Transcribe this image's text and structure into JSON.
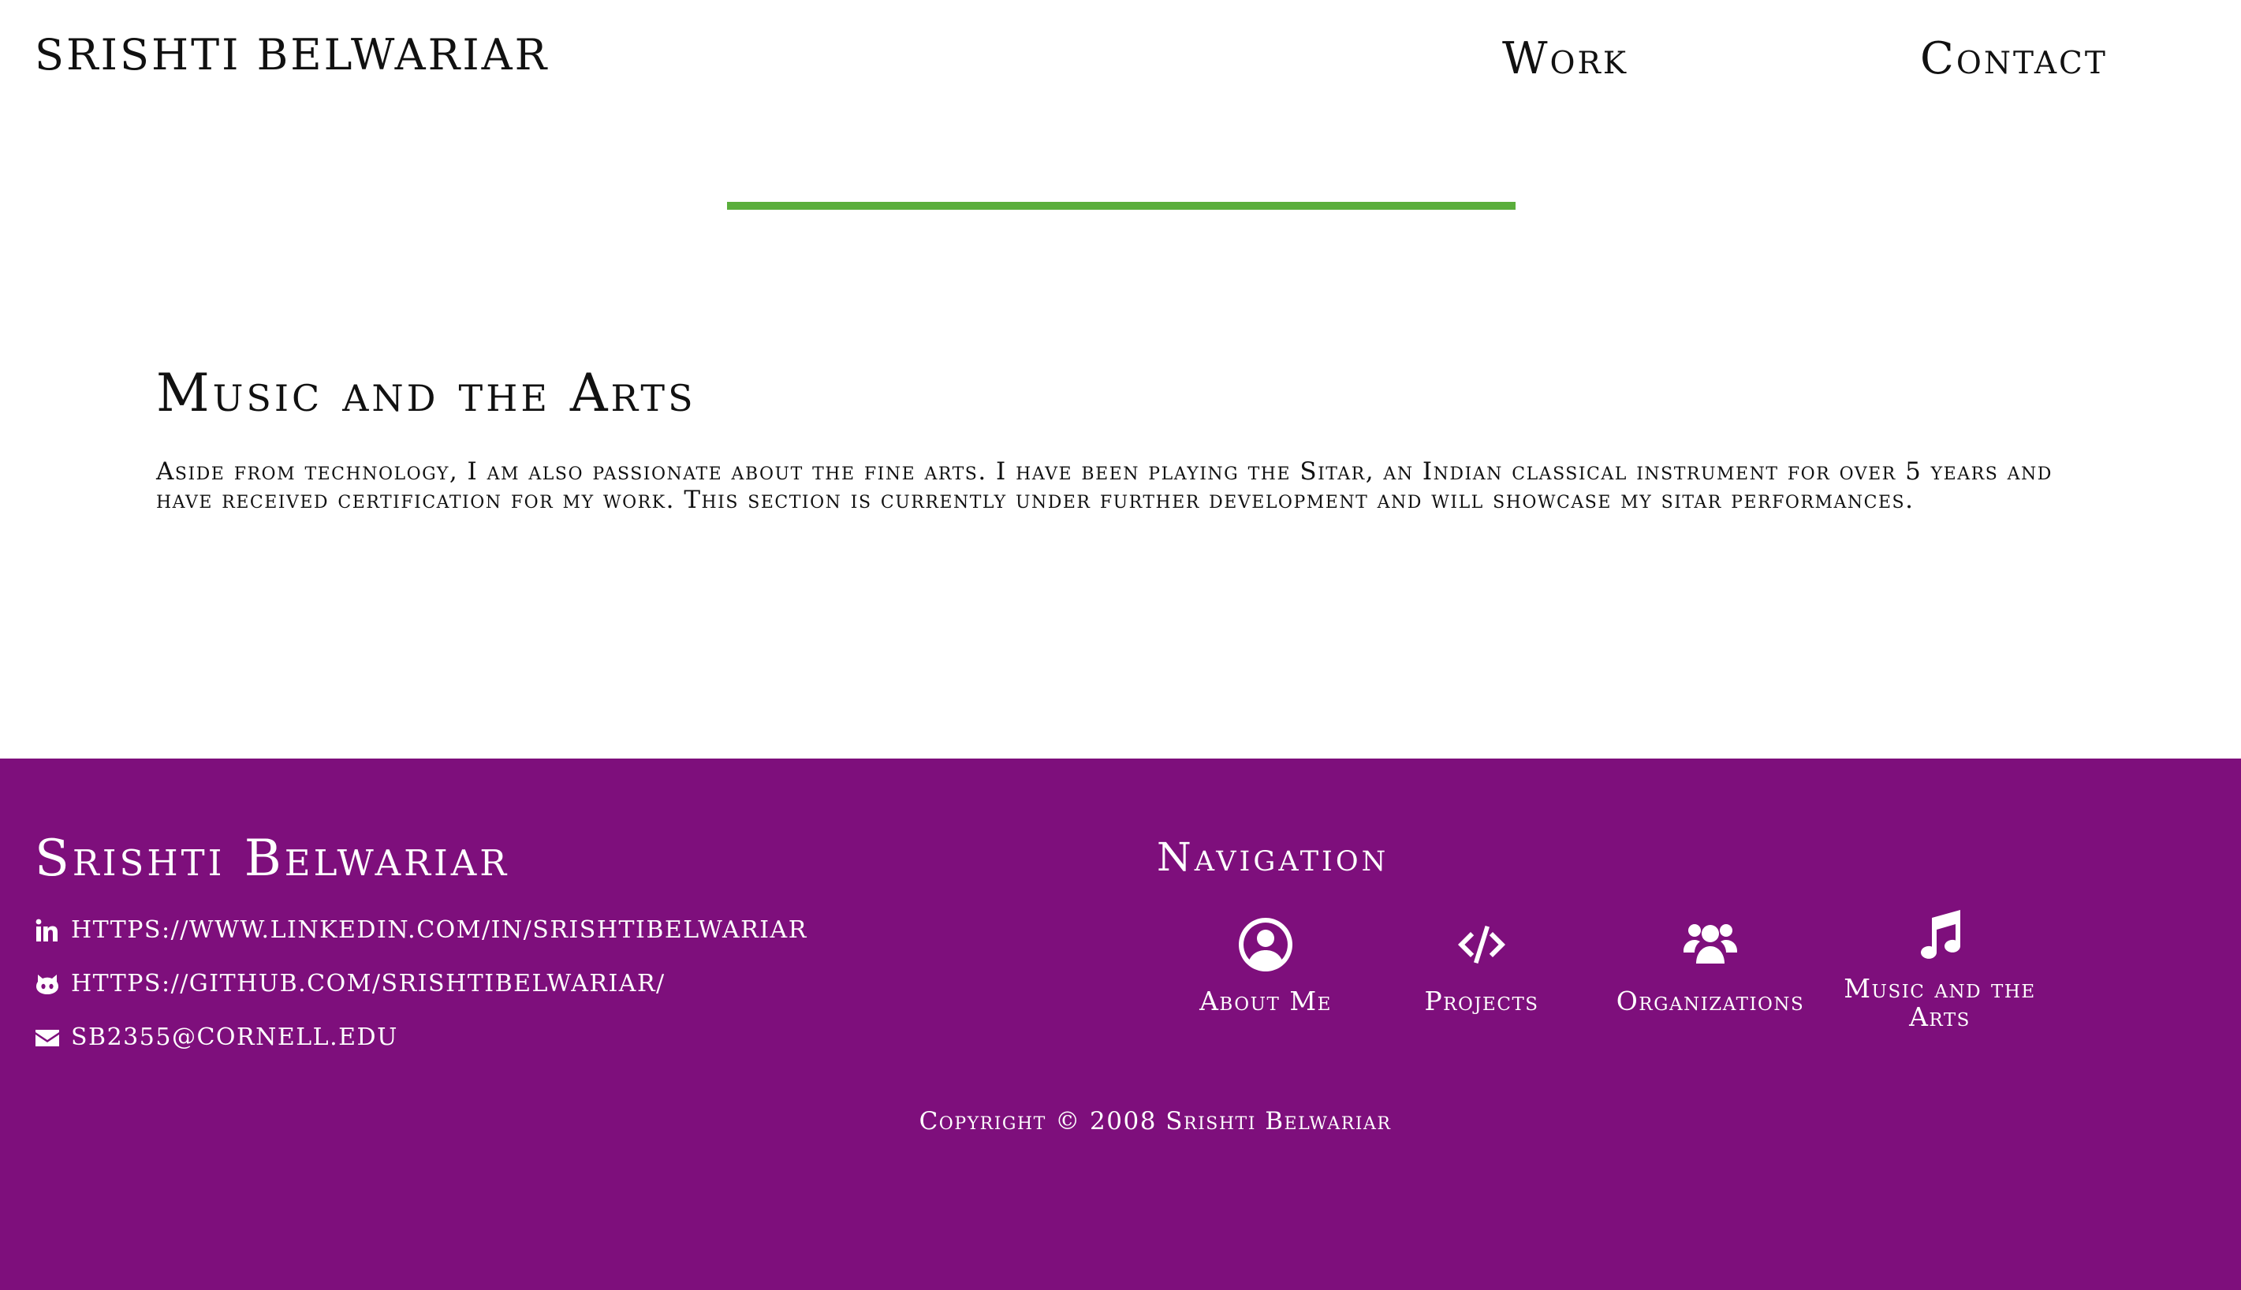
{
  "header": {
    "brand": "SRISHTI BELWARIAR",
    "nav": {
      "work": "Work",
      "contact": "Contact"
    }
  },
  "accent_color": "#5aae3c",
  "section": {
    "title": "Music and the Arts",
    "body": "Aside from technology, I am also passionate about the fine arts. I have been playing the Sitar, an Indian classical instrument for over 5 years and have received certification for my work. This section is currently under further development and will showcase my sitar performances."
  },
  "footer": {
    "background_color": "#7e0f7c",
    "name": "Srishti Belwariar",
    "contacts": {
      "linkedin": "https://www.linkedin.com/in/srishtibelwariar",
      "github": "https://github.com/srishtibelwariar/",
      "email": "sb2355@cornell.edu"
    },
    "navigation": {
      "heading": "Navigation",
      "items": [
        {
          "label": "About Me",
          "icon": "user-circle-icon"
        },
        {
          "label": "Projects",
          "icon": "code-icon"
        },
        {
          "label": "Organizations",
          "icon": "users-icon"
        },
        {
          "label": "Music and the Arts",
          "icon": "music-icon"
        }
      ]
    },
    "copyright": "Copyright © 2008 Srishti Belwariar"
  }
}
